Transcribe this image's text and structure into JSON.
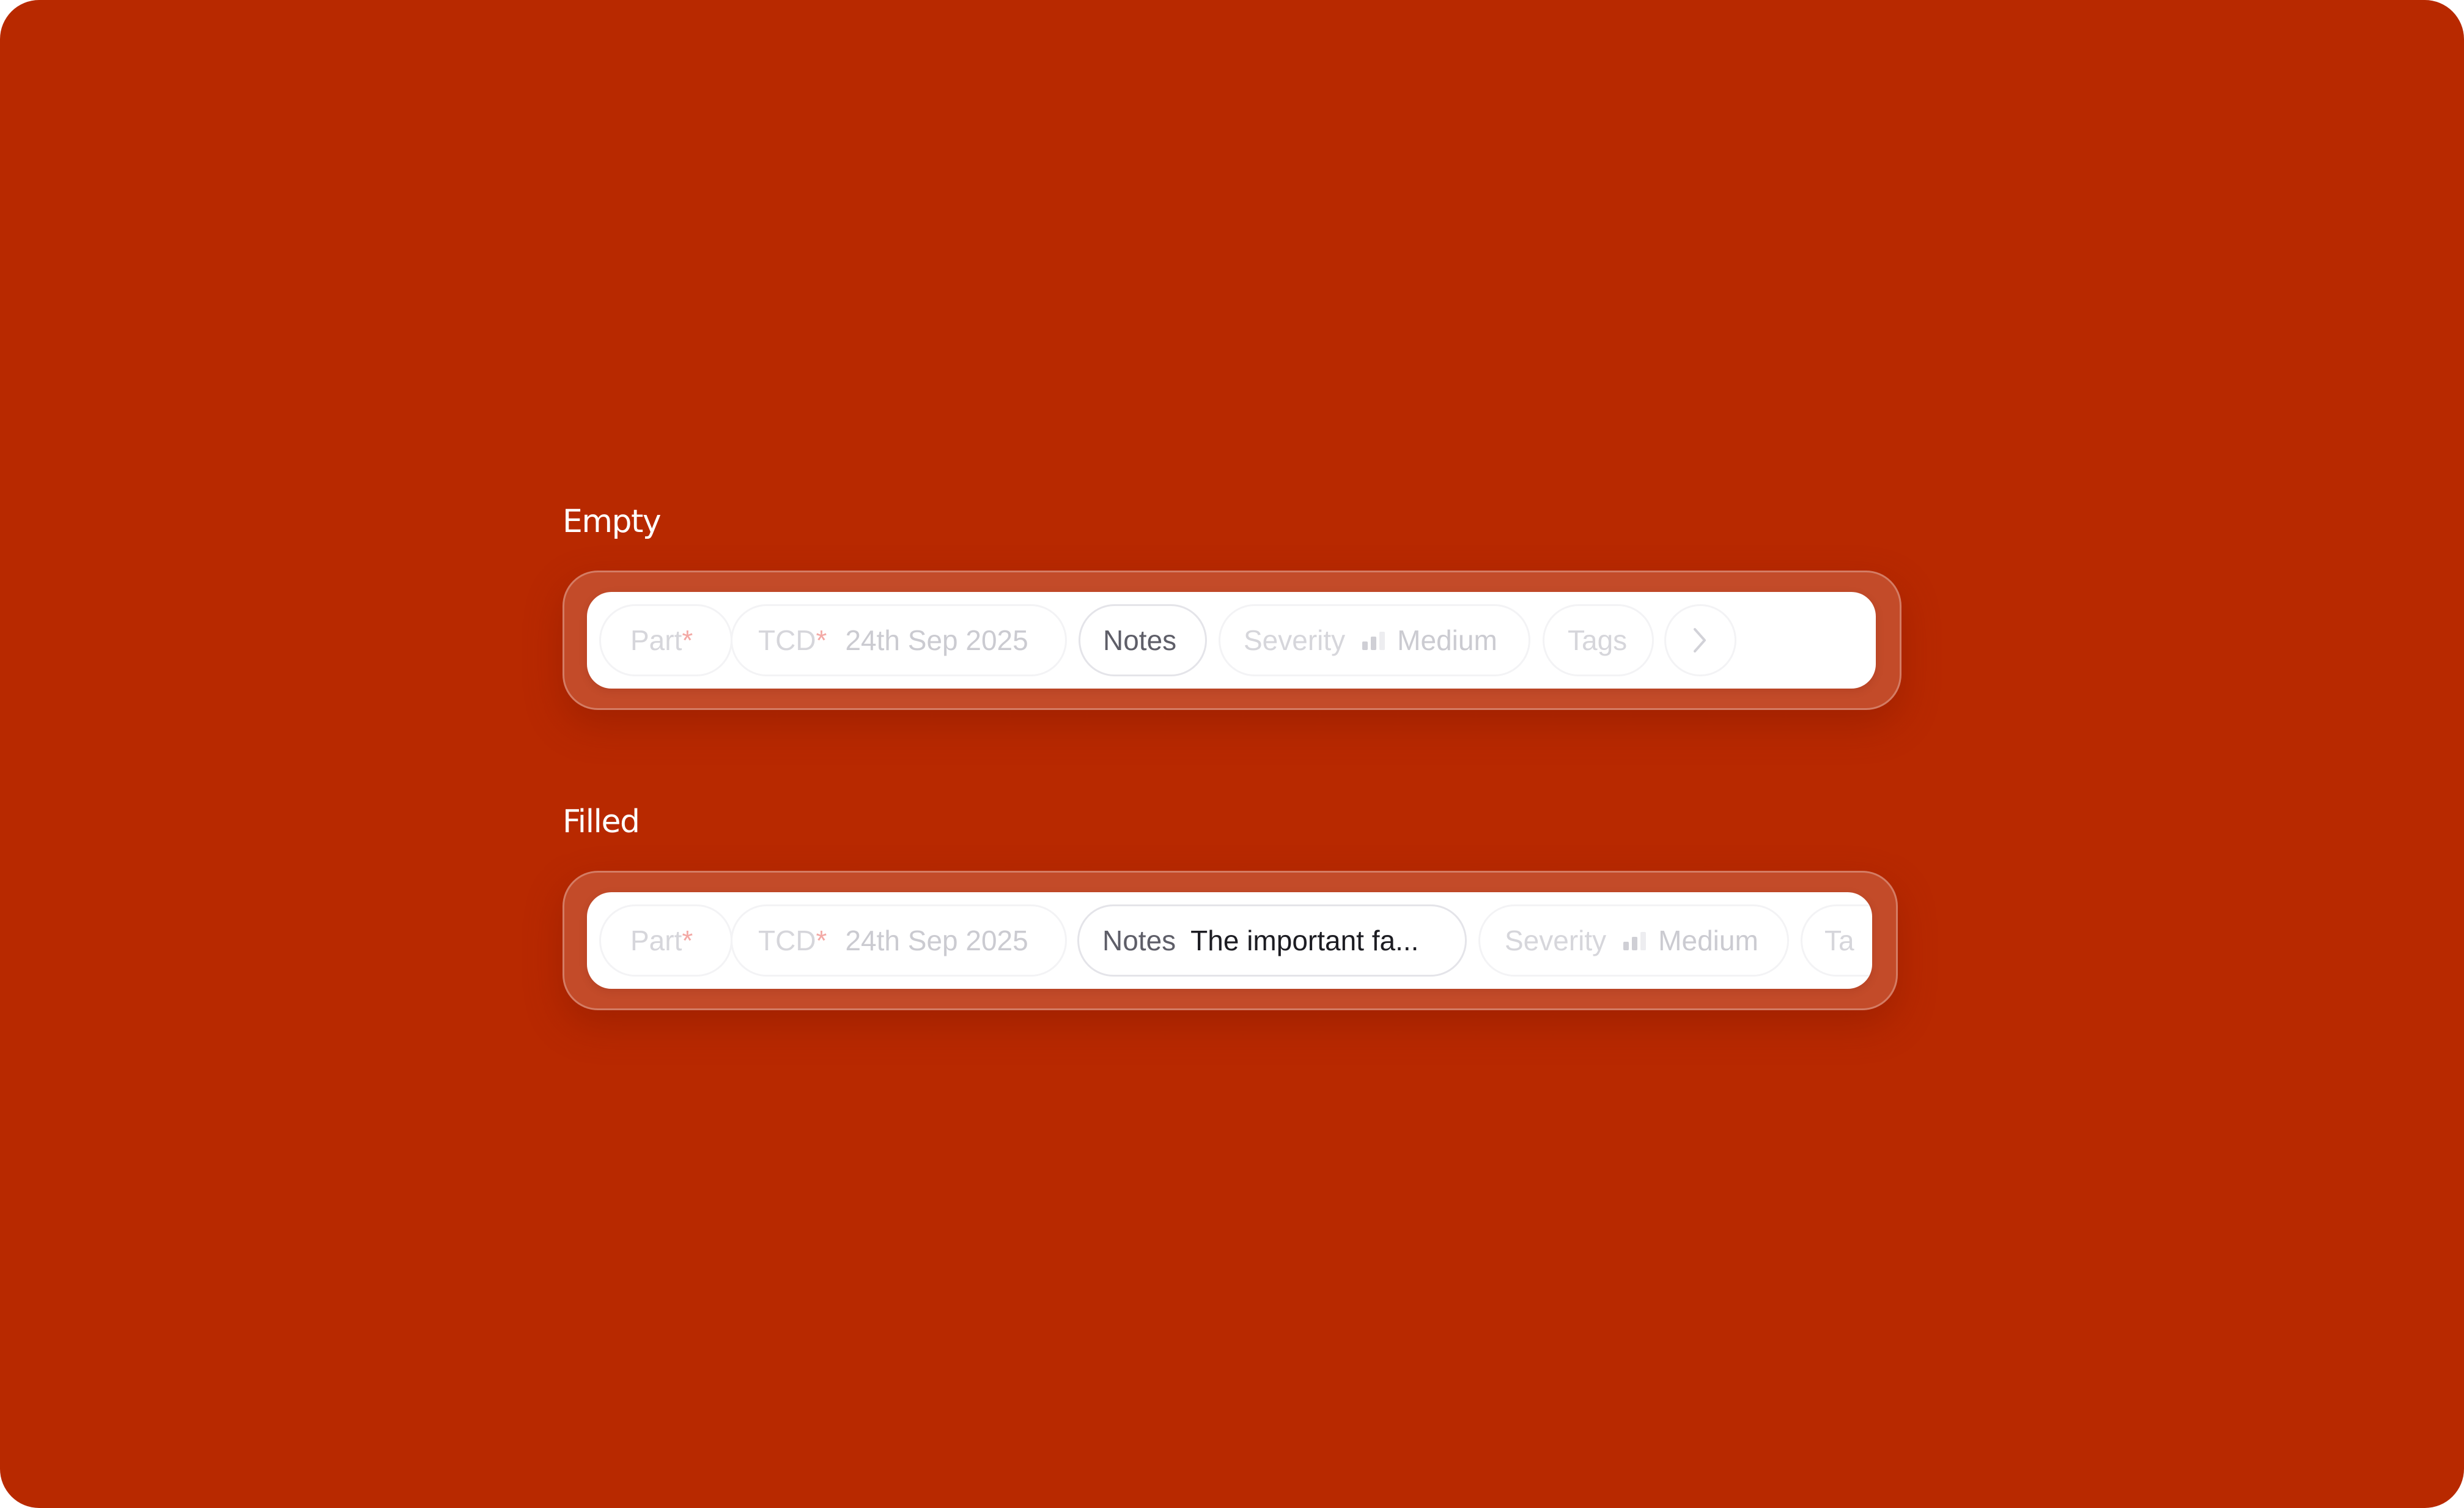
{
  "colors": {
    "background": "#B82900",
    "bar": "#FFFFFF",
    "required_marker": "#F3A9A5",
    "active_label": "#5E5E68",
    "active_value": "#1C1C22",
    "muted_text": "#D6D6DB"
  },
  "empty": {
    "section_label": "Empty",
    "part": {
      "label": "Part",
      "required": "*"
    },
    "tcd": {
      "label": "TCD",
      "required": "*",
      "value": "24th Sep 2025"
    },
    "notes": {
      "label": "Notes"
    },
    "severity": {
      "label": "Severity",
      "icon": "signal-bars-icon",
      "value": "Medium",
      "level_bars": 2,
      "total_bars": 3
    },
    "tags": {
      "label": "Tags"
    },
    "next_button": {
      "icon": "chevron-right-icon"
    }
  },
  "filled": {
    "section_label": "Filled",
    "part": {
      "label": "Part",
      "required": "*"
    },
    "tcd": {
      "label": "TCD",
      "required": "*",
      "value": "24th Sep 2025"
    },
    "notes": {
      "label": "Notes",
      "value": "The important fa..."
    },
    "severity": {
      "label": "Severity",
      "icon": "signal-bars-icon",
      "value": "Medium",
      "level_bars": 2,
      "total_bars": 3
    },
    "tags": {
      "label": "Ta"
    }
  }
}
